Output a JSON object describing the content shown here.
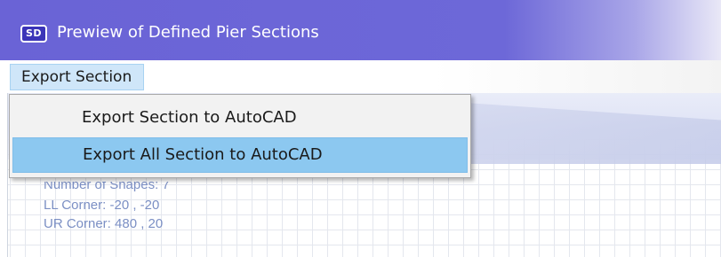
{
  "app": {
    "badge": "SD",
    "title": "Prewiew of Defined Pier Sections"
  },
  "menubar": {
    "items": [
      {
        "label": "Export Section"
      }
    ]
  },
  "dropdown": {
    "items": [
      {
        "label": "Export Section to AutoCAD",
        "highlighted": false
      },
      {
        "label": "Export All Section to AutoCAD",
        "highlighted": true
      }
    ]
  },
  "canvas": {
    "info": {
      "shapes": "Number of Shapes: 7",
      "ll_corner": "LL Corner: -20 , -20",
      "ur_corner": "UR Corner: 480 , 20"
    }
  },
  "colors": {
    "titlebar": "#6a63d6",
    "menu_highlight": "#cfe6f9",
    "item_highlight": "#8cc8f0",
    "info_text": "#7b8fc4"
  }
}
